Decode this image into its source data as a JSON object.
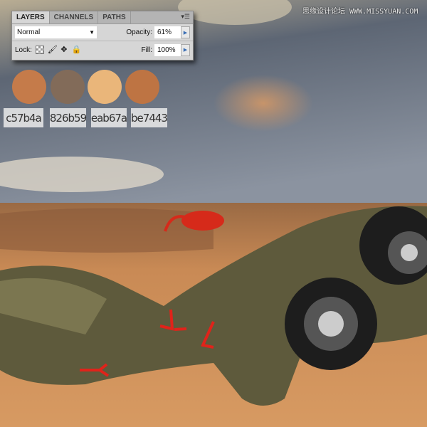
{
  "watermark": "思缘设计论坛 WWW.MISSYUAN.COM",
  "layers_panel": {
    "tabs": [
      {
        "label": "LAYERS",
        "active": true
      },
      {
        "label": "CHANNELS",
        "active": false
      },
      {
        "label": "PATHS",
        "active": false
      }
    ],
    "menu_icon": "panel-menu-icon",
    "blend_mode": "Normal",
    "opacity_label": "Opacity:",
    "opacity_value": "61%",
    "lock_label": "Lock:",
    "lock_icons": [
      "lock-transparent-icon",
      "lock-brush-icon",
      "lock-move-icon",
      "lock-all-icon"
    ],
    "fill_label": "Fill:",
    "fill_value": "100%"
  },
  "swatches": [
    {
      "hex": "c57b4a",
      "color": "#c57b4a"
    },
    {
      "hex": "826b59",
      "color": "#826b59"
    },
    {
      "hex": "eab67a",
      "color": "#eab67a"
    },
    {
      "hex": "be7443",
      "color": "#be7443"
    }
  ]
}
